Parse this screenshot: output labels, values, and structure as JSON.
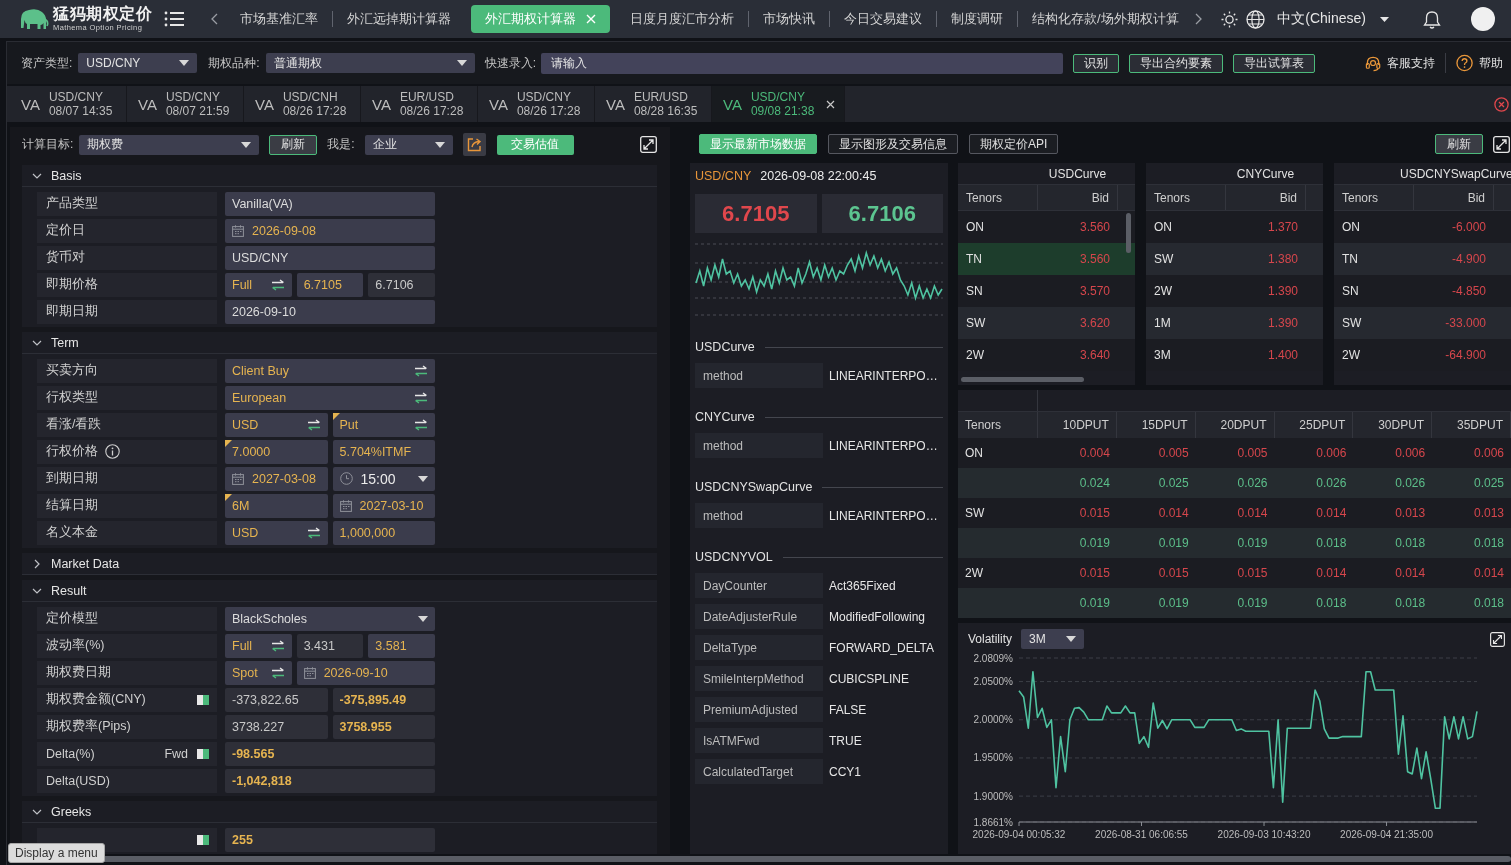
{
  "nav": {
    "brand": "猛犸期权定价",
    "brand_subtitle": "Mathema Option Pricing",
    "tabs": [
      {
        "label": "市场基准汇率",
        "selected": false
      },
      {
        "label": "外汇远掉期计算器",
        "selected": false
      },
      {
        "label": "外汇期权计算器",
        "selected": true
      },
      {
        "label": "日度月度汇市分析",
        "selected": false
      },
      {
        "label": "市场快讯",
        "selected": false
      },
      {
        "label": "今日交易建议",
        "selected": false
      },
      {
        "label": "制度调研",
        "selected": false
      },
      {
        "label": "结构化存款/场外期权计算",
        "selected": false
      }
    ],
    "language": "中文(Chinese)"
  },
  "toolbar": {
    "asset_label": "资产类型:",
    "asset": "USD/CNY",
    "variety_label": "期权品种:",
    "variety": "普通期权",
    "quick_label": "快速录入:",
    "quick_placeholder": "请输入",
    "buttons": [
      "识别",
      "导出合约要素",
      "导出试算表"
    ],
    "support": "客服支持",
    "help": "帮助"
  },
  "history_tabs": [
    {
      "type": "VA",
      "pair": "USD/CNY",
      "time": "08/07 14:35",
      "selected": false
    },
    {
      "type": "VA",
      "pair": "USD/CNY",
      "time": "08/07 21:59",
      "selected": false
    },
    {
      "type": "VA",
      "pair": "USD/CNH",
      "time": "08/26 17:28",
      "selected": false
    },
    {
      "type": "VA",
      "pair": "EUR/USD",
      "time": "08/26 17:28",
      "selected": false
    },
    {
      "type": "VA",
      "pair": "USD/CNY",
      "time": "08/26 17:28",
      "selected": false
    },
    {
      "type": "VA",
      "pair": "EUR/USD",
      "time": "08/28 16:35",
      "selected": false
    },
    {
      "type": "VA",
      "pair": "USD/CNY",
      "time": "09/08 21:38",
      "selected": true
    }
  ],
  "calc_bar": {
    "target_label": "计算目标:",
    "target": "期权费",
    "refresh": "刷新",
    "role_label": "我是:",
    "role": "企业",
    "valuation": "交易估值"
  },
  "sections": [
    {
      "title": "Basis",
      "expanded": true,
      "rows": [
        {
          "label": "产品类型",
          "cells": [
            {
              "kind": "text",
              "value": "Vanilla(VA)",
              "editable": true,
              "accent": false,
              "bold": false,
              "flagged": false
            }
          ]
        },
        {
          "label": "定价日",
          "cells": [
            {
              "kind": "date",
              "value": "2026-09-08",
              "editable": true,
              "accent": true,
              "bold": false,
              "flagged": false
            }
          ]
        },
        {
          "label": "货币对",
          "cells": [
            {
              "kind": "text",
              "value": "USD/CNY",
              "editable": true,
              "accent": false,
              "bold": false,
              "flagged": false
            }
          ]
        },
        {
          "label": "即期价格",
          "cells": [
            {
              "kind": "mode",
              "value": "Full",
              "editable": true,
              "accent": true,
              "bold": false,
              "flagged": false
            },
            {
              "kind": "text",
              "value": "6.7105",
              "editable": true,
              "accent": true,
              "bold": false,
              "flagged": false
            },
            {
              "kind": "text",
              "value": "6.7106",
              "editable": false,
              "accent": false,
              "bold": false,
              "flagged": false
            }
          ]
        },
        {
          "label": "即期日期",
          "cells": [
            {
              "kind": "text",
              "value": "2026-09-10",
              "editable": true,
              "accent": false,
              "bold": false,
              "flagged": false
            }
          ]
        }
      ]
    },
    {
      "title": "Term",
      "expanded": true,
      "rows": [
        {
          "label": "买卖方向",
          "cells": [
            {
              "kind": "swap",
              "value": "Client Buy",
              "editable": true,
              "accent": true,
              "bold": false,
              "flagged": false
            }
          ]
        },
        {
          "label": "行权类型",
          "cells": [
            {
              "kind": "swap",
              "value": "European",
              "editable": true,
              "accent": true,
              "bold": false,
              "flagged": false
            }
          ]
        },
        {
          "label": "看涨/看跌",
          "cells": [
            {
              "kind": "swap",
              "value": "USD",
              "editable": true,
              "accent": true,
              "bold": false,
              "flagged": false
            },
            {
              "kind": "swap",
              "value": "Put",
              "editable": true,
              "accent": true,
              "bold": false,
              "flagged": true
            }
          ]
        },
        {
          "label": "行权价格",
          "info": true,
          "cells": [
            {
              "kind": "text",
              "value": "7.0000",
              "editable": true,
              "accent": true,
              "bold": false,
              "flagged": true
            },
            {
              "kind": "text",
              "value": "5.704%ITMF",
              "editable": true,
              "accent": true,
              "bold": false,
              "flagged": false
            }
          ]
        },
        {
          "label": "到期日期",
          "cells": [
            {
              "kind": "date",
              "value": "2027-03-08",
              "editable": true,
              "accent": true,
              "bold": false,
              "flagged": false
            },
            {
              "kind": "time",
              "value": "15:00",
              "editable": true,
              "accent": false,
              "bold": false,
              "flagged": false
            }
          ]
        },
        {
          "label": "结算日期",
          "cells": [
            {
              "kind": "text",
              "value": "6M",
              "editable": true,
              "accent": true,
              "bold": false,
              "flagged": true
            },
            {
              "kind": "date",
              "value": "2027-03-10",
              "editable": true,
              "accent": true,
              "bold": false,
              "flagged": false
            }
          ]
        },
        {
          "label": "名义本金",
          "cells": [
            {
              "kind": "swap",
              "value": "USD",
              "editable": true,
              "accent": true,
              "bold": false,
              "flagged": false
            },
            {
              "kind": "text",
              "value": "1,000,000",
              "editable": true,
              "accent": true,
              "bold": false,
              "flagged": false
            }
          ]
        }
      ]
    },
    {
      "title": "Market Data",
      "expanded": false
    },
    {
      "title": "Result",
      "expanded": true,
      "rows": [
        {
          "label": "定价模型",
          "cells": [
            {
              "kind": "select",
              "value": "BlackScholes",
              "editable": true,
              "accent": false,
              "bold": false,
              "flagged": false
            }
          ]
        },
        {
          "label": "波动率(%)",
          "cells": [
            {
              "kind": "mode",
              "value": "Full",
              "editable": true,
              "accent": true,
              "bold": false,
              "flagged": false
            },
            {
              "kind": "text",
              "value": "3.431",
              "editable": false,
              "accent": false,
              "bold": false,
              "flagged": false
            },
            {
              "kind": "text",
              "value": "3.581",
              "editable": true,
              "accent": true,
              "bold": false,
              "flagged": false
            }
          ]
        },
        {
          "label": "期权费日期",
          "cells": [
            {
              "kind": "mode",
              "value": "Spot",
              "editable": true,
              "accent": true,
              "bold": false,
              "flagged": false
            },
            {
              "kind": "date",
              "value": "2026-09-10",
              "editable": true,
              "accent": true,
              "bold": false,
              "flagged": false
            }
          ]
        },
        {
          "label": "期权费金额(CNY)",
          "toggle": true,
          "cells": [
            {
              "kind": "text",
              "value": "-373,822.65",
              "editable": false,
              "accent": false,
              "bold": false,
              "flagged": false
            },
            {
              "kind": "text",
              "value": "-375,895.49",
              "editable": false,
              "accent": true,
              "bold": true,
              "flagged": false
            }
          ]
        },
        {
          "label": "期权费率(Pips)",
          "cells": [
            {
              "kind": "text",
              "value": "3738.227",
              "editable": false,
              "accent": false,
              "bold": false,
              "flagged": false
            },
            {
              "kind": "text",
              "value": "3758.955",
              "editable": false,
              "accent": true,
              "bold": true,
              "flagged": false
            }
          ]
        },
        {
          "label": "Delta(%)",
          "suffix": "Fwd",
          "toggle": true,
          "cells": [
            {
              "kind": "text",
              "value": "-98.565",
              "editable": false,
              "accent": true,
              "bold": true,
              "flagged": false
            }
          ]
        },
        {
          "label": "Delta(USD)",
          "cells": [
            {
              "kind": "text",
              "value": "-1,042,818",
              "editable": false,
              "accent": true,
              "bold": true,
              "flagged": false
            }
          ]
        }
      ]
    },
    {
      "title": "Greeks",
      "expanded": true,
      "rows": [
        {
          "toggle": true,
          "cells": [
            {
              "kind": "text",
              "value": "255",
              "editable": false,
              "accent": true,
              "bold": true,
              "flagged": false
            }
          ]
        }
      ]
    }
  ],
  "market": {
    "buttons": [
      {
        "label": "显示最新市场数据",
        "selected": true
      },
      {
        "label": "显示图形及交易信息",
        "selected": false
      },
      {
        "label": "期权定价API",
        "selected": false
      }
    ],
    "refresh": "刷新"
  },
  "quote": {
    "pair": "USD/CNY",
    "time": "2026-09-08 22:00:45",
    "bid": "6.7105",
    "ask": "6.7106"
  },
  "settings": [
    {
      "title": "USDCurve",
      "items": [
        {
          "key": "method",
          "value": "LINEARINTERPO…"
        }
      ]
    },
    {
      "title": "CNYCurve",
      "items": [
        {
          "key": "method",
          "value": "LINEARINTERPO…"
        }
      ]
    },
    {
      "title": "USDCNYSwapCurve",
      "items": [
        {
          "key": "method",
          "value": "LINEARINTERPO…"
        }
      ]
    },
    {
      "title": "USDCNYVOL",
      "items": [
        {
          "key": "DayCounter",
          "value": "Act365Fixed"
        },
        {
          "key": "DateAdjusterRule",
          "value": "ModifiedFollowing"
        },
        {
          "key": "DeltaType",
          "value": "FORWARD_DELTA"
        },
        {
          "key": "SmileInterpMethod",
          "value": "CUBICSPLINE"
        },
        {
          "key": "PremiumAdjusted",
          "value": "FALSE"
        },
        {
          "key": "IsATMFwd",
          "value": "TRUE"
        },
        {
          "key": "CalculatedTarget",
          "value": "CCY1"
        }
      ]
    }
  ],
  "curves": [
    {
      "title": "USDCurve",
      "columns": [
        "Tenors",
        "Bid"
      ],
      "rows": [
        {
          "tenor": "ON",
          "bid": "3.560",
          "hovered": false
        },
        {
          "tenor": "TN",
          "bid": "3.560",
          "hovered": true
        },
        {
          "tenor": "SN",
          "bid": "3.570",
          "hovered": false
        },
        {
          "tenor": "SW",
          "bid": "3.620",
          "hovered": false
        },
        {
          "tenor": "2W",
          "bid": "3.640",
          "hovered": false
        }
      ]
    },
    {
      "title": "CNYCurve",
      "columns": [
        "Tenors",
        "Bid"
      ],
      "rows": [
        {
          "tenor": "ON",
          "bid": "1.370",
          "hovered": false
        },
        {
          "tenor": "SW",
          "bid": "1.380",
          "hovered": false
        },
        {
          "tenor": "2W",
          "bid": "1.390",
          "hovered": false
        },
        {
          "tenor": "1M",
          "bid": "1.390",
          "hovered": false
        },
        {
          "tenor": "3M",
          "bid": "1.400",
          "hovered": false
        }
      ]
    },
    {
      "title": "USDCNYSwapCurve",
      "columns": [
        "Tenors",
        "Bid"
      ],
      "rows": [
        {
          "tenor": "ON",
          "bid": "-6.000",
          "hovered": false
        },
        {
          "tenor": "TN",
          "bid": "-4.900",
          "hovered": false
        },
        {
          "tenor": "SN",
          "bid": "-4.850",
          "hovered": false
        },
        {
          "tenor": "SW",
          "bid": "-33.000",
          "hovered": false
        },
        {
          "tenor": "2W",
          "bid": "-64.900",
          "hovered": false
        }
      ]
    }
  ],
  "vol_table": {
    "columns": [
      "Tenors",
      "10DPUT",
      "15DPUT",
      "20DPUT",
      "25DPUT",
      "30DPUT",
      "35DPUT"
    ],
    "rows": [
      {
        "tenor": "ON",
        "bid": [
          "0.004",
          "0.005",
          "0.005",
          "0.006",
          "0.006",
          "0.006"
        ],
        "ask": [
          "0.024",
          "0.025",
          "0.026",
          "0.026",
          "0.026",
          "0.025"
        ]
      },
      {
        "tenor": "SW",
        "bid": [
          "0.015",
          "0.014",
          "0.014",
          "0.014",
          "0.013",
          "0.013"
        ],
        "ask": [
          "0.019",
          "0.019",
          "0.019",
          "0.018",
          "0.018",
          "0.018"
        ]
      },
      {
        "tenor": "2W",
        "bid": [
          "0.015",
          "0.015",
          "0.015",
          "0.014",
          "0.014",
          "0.014"
        ],
        "ask": [
          "0.019",
          "0.019",
          "0.019",
          "0.018",
          "0.018",
          "0.018"
        ]
      }
    ]
  },
  "vol_chart": {
    "tenor": "3M",
    "x_labels": [
      "2026-09-04 00:05:32",
      "2026-08-31 06:06:55",
      "2026-09-03 10:43:20",
      "2026-09-04 21:35:00"
    ],
    "chart_data": {
      "type": "line",
      "grid": true,
      "ylim": [
        1.8661,
        2.0809
      ],
      "yticks": [
        {
          "value": 2.0809,
          "label": "2.0809%"
        },
        {
          "value": 2.05,
          "label": "2.0500%"
        },
        {
          "value": 2.0,
          "label": "2.0000%"
        },
        {
          "value": 1.95,
          "label": "1.9500%"
        },
        {
          "value": 1.9,
          "label": "1.9000%"
        },
        {
          "value": 1.8661,
          "label": "1.8661%"
        }
      ],
      "series": [
        {
          "name": "Volatility",
          "color": "#4fc3a1",
          "values": [
            2.038,
            2.03,
            1.989,
            2.063,
            2.003,
            2.015,
            1.99,
            2.0,
            1.911,
            1.978,
            1.932,
            2.0,
            2.015,
            2.016,
            2.01,
            2.0,
            2.0,
            2.0,
            2.0,
            2.018,
            2.009,
            2.009,
            2.009,
            2.018,
            2.009,
            2.009,
            1.969,
            1.978,
            1.964,
            2.022,
            1.989,
            1.999,
            1.988,
            2.0,
            2.0,
            2.0,
            2.0,
            2.0,
            1.99,
            1.99,
            1.99,
            2.0,
            2.0,
            2.0,
            2.0,
            2.0,
            2.0,
            1.986,
            1.988,
            1.985,
            1.985,
            1.985,
            1.985,
            1.985,
            1.985,
            1.911,
            2.0,
            1.892,
            1.989,
            1.989,
            1.989,
            1.989,
            1.989,
            1.989,
            2.039,
            2.025,
            1.988,
            1.976,
            1.976,
            1.976,
            1.978,
            1.978,
            1.978,
            1.978,
            1.978,
            2.063,
            2.063,
            2.039,
            2.039,
            2.039,
            2.039,
            2.039,
            1.955,
            2.005,
            1.932,
            1.929,
            1.963,
            1.923,
            1.958,
            1.923,
            1.884,
            1.884,
            2.004,
            1.975,
            2.004,
            1.975,
            2.004,
            1.975,
            1.978,
            2.011
          ]
        }
      ]
    }
  },
  "tooltip": "Display a menu"
}
